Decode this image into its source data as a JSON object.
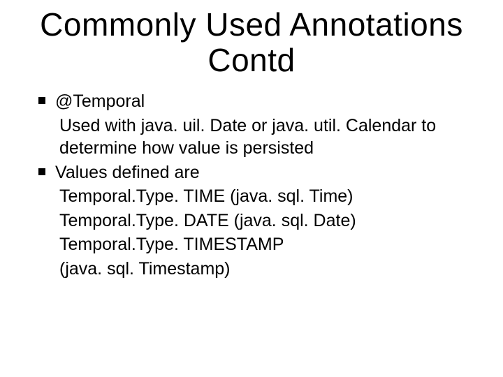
{
  "title": "Commonly Used Annotations  Contd",
  "bullets": [
    {
      "label": "@Temporal",
      "subs": [
        "Used  with  java. uil. Date  or java. util. Calendar to determine  how value is persisted"
      ]
    },
    {
      "label": "Values defined are",
      "subs": [
        "Temporal.Type. TIME (java. sql. Time)",
        "Temporal.Type. DATE (java. sql. Date)",
        "Temporal.Type. TIMESTAMP",
        "(java. sql. Timestamp)"
      ]
    }
  ]
}
